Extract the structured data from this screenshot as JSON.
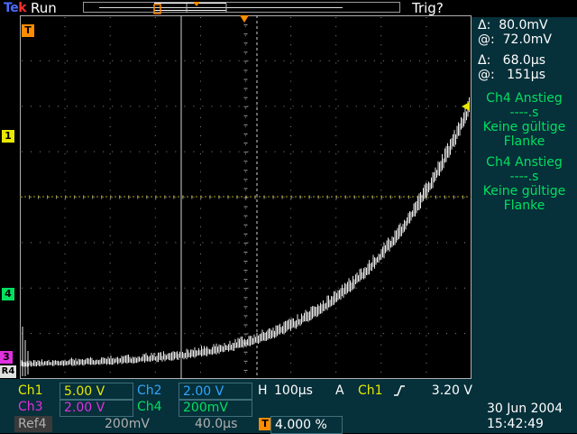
{
  "brand": {
    "part1": "Te",
    "part2": "k"
  },
  "status": {
    "run": "Run",
    "trigger": "Trig?"
  },
  "cursor": {
    "delta_v_label": "Δ:",
    "delta_v": "80.0mV",
    "at_v_label": "@:",
    "at_v": "72.0mV",
    "delta_t_label": "Δ:",
    "delta_t": "68.0µs",
    "at_t_label": "@:",
    "at_t": "151µs"
  },
  "measurements": [
    {
      "line1": "Ch4 Anstieg",
      "line2": "----.s",
      "line3": "Keine gültige",
      "line4": "Flanke"
    },
    {
      "line1": "Ch4 Anstieg",
      "line2": "----.s",
      "line3": "Keine gültige",
      "line4": "Flanke"
    }
  ],
  "channels": {
    "ch1": {
      "label": "Ch1",
      "value": "5.00 V"
    },
    "ch2": {
      "label": "Ch2",
      "value": "2.00 V"
    },
    "ch3": {
      "label": "Ch3",
      "value": "2.00 V"
    },
    "ch4": {
      "label": "Ch4",
      "value": "200mV"
    },
    "ref4": {
      "label": "Ref4",
      "volts": "200mV",
      "time": "40.0µs"
    }
  },
  "horizontal": {
    "label": "H",
    "value": "100µs"
  },
  "trigger": {
    "mode": "A",
    "source": "Ch1",
    "slope_icon": "rising-edge-icon",
    "level": "3.20 V",
    "position": "4.000 %"
  },
  "datetime": {
    "date": "30 Jun  2004",
    "time": "15:42:49"
  },
  "markers": {
    "trigger_pos": "T",
    "ch1": "1",
    "ch4": "4",
    "ch3": "3",
    "ref4": "R4"
  },
  "colors": {
    "ch1": "#e8e800",
    "ch2": "#2ea6ff",
    "ch3": "#e030e0",
    "ch4": "#00e060",
    "panel": "#06303a",
    "trigger": "#ff8c00"
  }
}
